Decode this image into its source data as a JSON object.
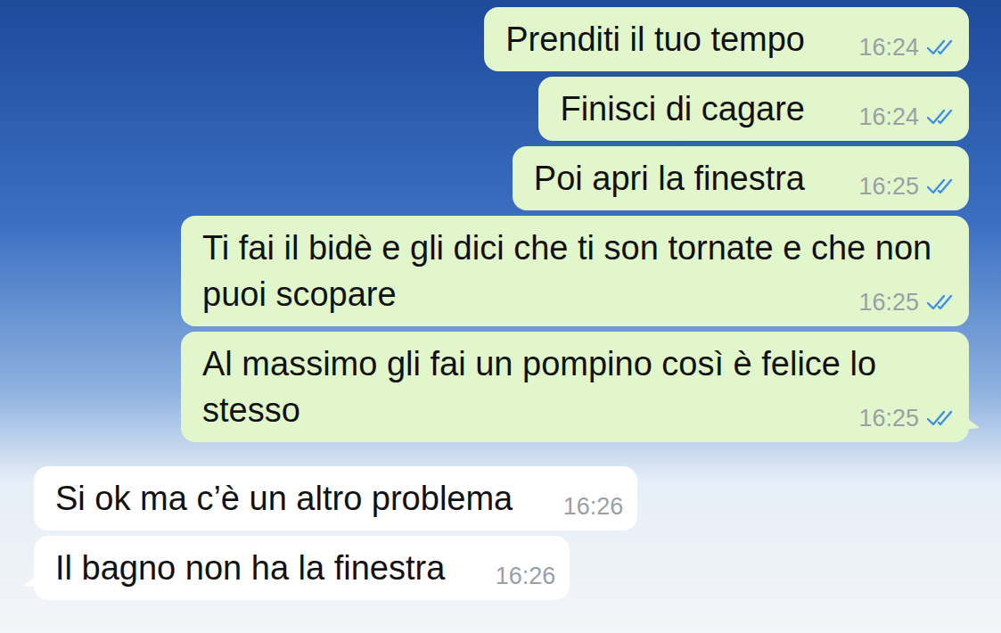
{
  "chat": {
    "messages": [
      {
        "text": "Prenditi il tuo tempo",
        "time": "16:24",
        "outgoing": true,
        "read": true,
        "tail": false
      },
      {
        "text": "Finisci di cagare",
        "time": "16:24",
        "outgoing": true,
        "read": true,
        "tail": false
      },
      {
        "text": "Poi apri la finestra",
        "time": "16:25",
        "outgoing": true,
        "read": true,
        "tail": false
      },
      {
        "text": "Ti fai il bidè e gli dici che ti son tornate e che non puoi scopare",
        "time": "16:25",
        "outgoing": true,
        "read": true,
        "tail": false
      },
      {
        "text": "Al massimo gli fai un pompino così è felice lo stesso",
        "time": "16:25",
        "outgoing": true,
        "read": true,
        "tail": true
      },
      {
        "text": "Si ok ma c’è un altro problema",
        "time": "16:26",
        "outgoing": false,
        "read": false,
        "tail": false
      },
      {
        "text": "Il bagno non ha la finestra",
        "time": "16:26",
        "outgoing": false,
        "read": false,
        "tail": true
      }
    ]
  }
}
